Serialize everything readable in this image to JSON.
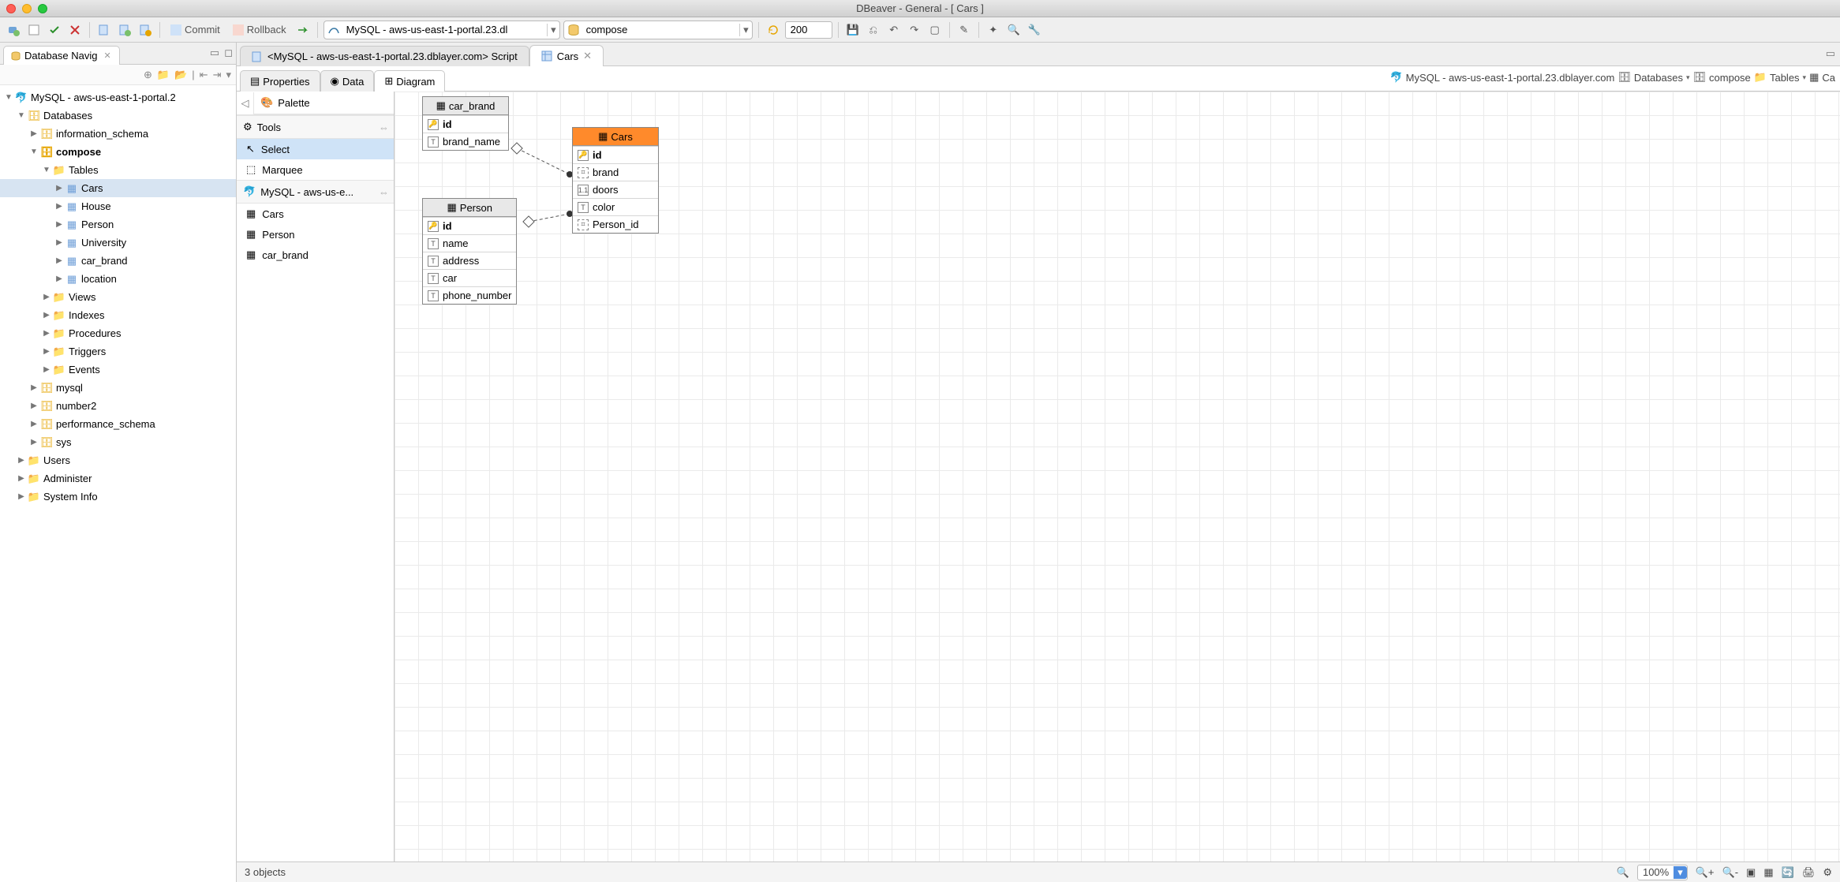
{
  "window": {
    "title": "DBeaver - General - [ Cars ]"
  },
  "toolbar": {
    "commit": "Commit",
    "rollback": "Rollback",
    "conn_combo": "MySQL - aws-us-east-1-portal.23.dl",
    "db_combo": "compose",
    "rows_value": "200"
  },
  "nav_panel": {
    "tab": "Database Navig",
    "tree": {
      "conn": "MySQL - aws-us-east-1-portal.2",
      "databases_label": "Databases",
      "dbs": [
        "information_schema"
      ],
      "compose": "compose",
      "tables_label": "Tables",
      "tables": [
        "Cars",
        "House",
        "Person",
        "University",
        "car_brand",
        "location"
      ],
      "folders": [
        "Views",
        "Indexes",
        "Procedures",
        "Triggers",
        "Events"
      ],
      "other_dbs": [
        "mysql",
        "number2",
        "performance_schema",
        "sys"
      ],
      "root_folders": [
        "Users",
        "Administer",
        "System Info"
      ]
    }
  },
  "editor": {
    "tab_script": "<MySQL - aws-us-east-1-portal.23.dblayer.com> Script",
    "tab_cars": "Cars",
    "subtabs": {
      "properties": "Properties",
      "data": "Data",
      "diagram": "Diagram"
    },
    "breadcrumb": {
      "conn": "MySQL - aws-us-east-1-portal.23.dblayer.com",
      "databases": "Databases",
      "db": "compose",
      "tables": "Tables",
      "table_short": "Ca"
    }
  },
  "palette": {
    "title": "Palette",
    "tools": "Tools",
    "select": "Select",
    "marquee": "Marquee",
    "group": "MySQL - aws-us-e...",
    "items": [
      "Cars",
      "Person",
      "car_brand"
    ]
  },
  "entities": {
    "car_brand": {
      "title": "car_brand",
      "cols": [
        {
          "name": "id",
          "kind": "pk"
        },
        {
          "name": "brand_name",
          "kind": "t"
        }
      ]
    },
    "cars": {
      "title": "Cars",
      "cols": [
        {
          "name": "id",
          "kind": "pk"
        },
        {
          "name": "brand",
          "kind": "fk"
        },
        {
          "name": "doors",
          "kind": "n"
        },
        {
          "name": "color",
          "kind": "t"
        },
        {
          "name": "Person_id",
          "kind": "fk"
        }
      ]
    },
    "person": {
      "title": "Person",
      "cols": [
        {
          "name": "id",
          "kind": "pk"
        },
        {
          "name": "name",
          "kind": "t"
        },
        {
          "name": "address",
          "kind": "t"
        },
        {
          "name": "car",
          "kind": "t"
        },
        {
          "name": "phone_number",
          "kind": "t"
        }
      ]
    }
  },
  "status": {
    "objects": "3 objects",
    "zoom": "100%"
  }
}
